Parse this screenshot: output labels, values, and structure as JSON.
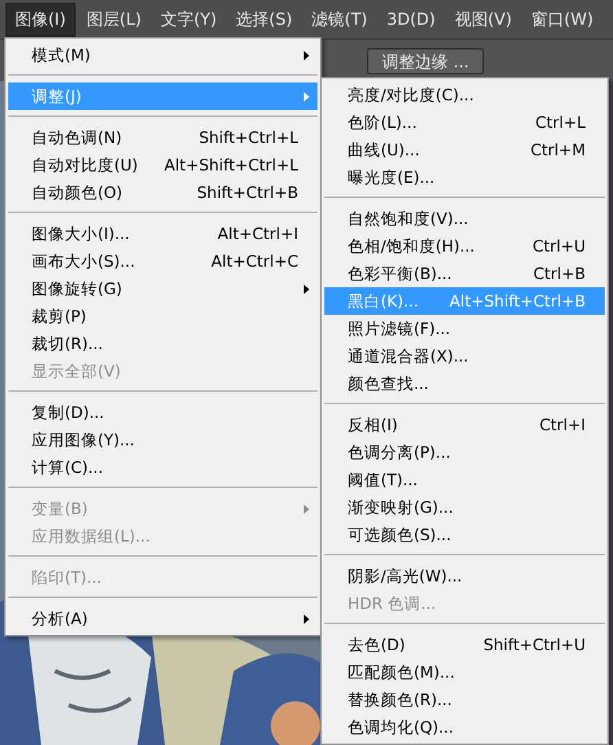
{
  "menu_bar": [
    {
      "label": "图像(I)",
      "selected": true
    },
    {
      "label": "图层(L)",
      "selected": false
    },
    {
      "label": "文字(Y)",
      "selected": false
    },
    {
      "label": "选择(S)",
      "selected": false
    },
    {
      "label": "滤镜(T)",
      "selected": false
    },
    {
      "label": "3D(D)",
      "selected": false
    },
    {
      "label": "视图(V)",
      "selected": false
    },
    {
      "label": "窗口(W)",
      "selected": false
    }
  ],
  "toolbar": {
    "button": "调整边缘 ..."
  },
  "image_menu": {
    "items": [
      {
        "kind": "item",
        "label": "模式(M)",
        "submenu": true,
        "disabled": false,
        "selected": false
      },
      {
        "kind": "separator"
      },
      {
        "kind": "item",
        "label": "调整(J)",
        "submenu": true,
        "disabled": false,
        "selected": true
      },
      {
        "kind": "separator"
      },
      {
        "kind": "item",
        "label": "自动色调(N)",
        "shortcut": "Shift+Ctrl+L",
        "disabled": false,
        "selected": false
      },
      {
        "kind": "item",
        "label": "自动对比度(U)",
        "shortcut": "Alt+Shift+Ctrl+L",
        "disabled": false,
        "selected": false
      },
      {
        "kind": "item",
        "label": "自动颜色(O)",
        "shortcut": "Shift+Ctrl+B",
        "disabled": false,
        "selected": false
      },
      {
        "kind": "separator"
      },
      {
        "kind": "item",
        "label": "图像大小(I)...",
        "shortcut": "Alt+Ctrl+I",
        "disabled": false,
        "selected": false
      },
      {
        "kind": "item",
        "label": "画布大小(S)...",
        "shortcut": "Alt+Ctrl+C",
        "disabled": false,
        "selected": false
      },
      {
        "kind": "item",
        "label": "图像旋转(G)",
        "submenu": true,
        "disabled": false,
        "selected": false
      },
      {
        "kind": "item",
        "label": "裁剪(P)",
        "disabled": false,
        "selected": false
      },
      {
        "kind": "item",
        "label": "裁切(R)...",
        "disabled": false,
        "selected": false
      },
      {
        "kind": "item",
        "label": "显示全部(V)",
        "disabled": true,
        "selected": false
      },
      {
        "kind": "separator"
      },
      {
        "kind": "item",
        "label": "复制(D)...",
        "disabled": false,
        "selected": false
      },
      {
        "kind": "item",
        "label": "应用图像(Y)...",
        "disabled": false,
        "selected": false
      },
      {
        "kind": "item",
        "label": "计算(C)...",
        "disabled": false,
        "selected": false
      },
      {
        "kind": "separator"
      },
      {
        "kind": "item",
        "label": "变量(B)",
        "submenu": true,
        "disabled": true,
        "selected": false
      },
      {
        "kind": "item",
        "label": "应用数据组(L)...",
        "disabled": true,
        "selected": false
      },
      {
        "kind": "separator"
      },
      {
        "kind": "item",
        "label": "陷印(T)...",
        "disabled": true,
        "selected": false
      },
      {
        "kind": "separator"
      },
      {
        "kind": "item",
        "label": "分析(A)",
        "submenu": true,
        "disabled": false,
        "selected": false
      }
    ]
  },
  "adjust_submenu": {
    "items": [
      {
        "kind": "item",
        "label": "亮度/对比度(C)...",
        "disabled": false,
        "selected": false
      },
      {
        "kind": "item",
        "label": "色阶(L)...",
        "shortcut": "Ctrl+L",
        "disabled": false,
        "selected": false
      },
      {
        "kind": "item",
        "label": "曲线(U)...",
        "shortcut": "Ctrl+M",
        "disabled": false,
        "selected": false
      },
      {
        "kind": "item",
        "label": "曝光度(E)...",
        "disabled": false,
        "selected": false
      },
      {
        "kind": "separator"
      },
      {
        "kind": "item",
        "label": "自然饱和度(V)...",
        "disabled": false,
        "selected": false
      },
      {
        "kind": "item",
        "label": "色相/饱和度(H)...",
        "shortcut": "Ctrl+U",
        "disabled": false,
        "selected": false
      },
      {
        "kind": "item",
        "label": "色彩平衡(B)...",
        "shortcut": "Ctrl+B",
        "disabled": false,
        "selected": false
      },
      {
        "kind": "item",
        "label": "黑白(K)...",
        "shortcut": "Alt+Shift+Ctrl+B",
        "disabled": false,
        "selected": true
      },
      {
        "kind": "item",
        "label": "照片滤镜(F)...",
        "disabled": false,
        "selected": false
      },
      {
        "kind": "item",
        "label": "通道混合器(X)...",
        "disabled": false,
        "selected": false
      },
      {
        "kind": "item",
        "label": "颜色查找...",
        "disabled": false,
        "selected": false
      },
      {
        "kind": "separator"
      },
      {
        "kind": "item",
        "label": "反相(I)",
        "shortcut": "Ctrl+I",
        "disabled": false,
        "selected": false
      },
      {
        "kind": "item",
        "label": "色调分离(P)...",
        "disabled": false,
        "selected": false
      },
      {
        "kind": "item",
        "label": "阈值(T)...",
        "disabled": false,
        "selected": false
      },
      {
        "kind": "item",
        "label": "渐变映射(G)...",
        "disabled": false,
        "selected": false
      },
      {
        "kind": "item",
        "label": "可选颜色(S)...",
        "disabled": false,
        "selected": false
      },
      {
        "kind": "separator"
      },
      {
        "kind": "item",
        "label": "阴影/高光(W)...",
        "disabled": false,
        "selected": false
      },
      {
        "kind": "item",
        "label": "HDR 色调...",
        "disabled": true,
        "selected": false
      },
      {
        "kind": "separator"
      },
      {
        "kind": "item",
        "label": "去色(D)",
        "shortcut": "Shift+Ctrl+U",
        "disabled": false,
        "selected": false
      },
      {
        "kind": "item",
        "label": "匹配颜色(M)...",
        "disabled": false,
        "selected": false
      },
      {
        "kind": "item",
        "label": "替换颜色(R)...",
        "disabled": false,
        "selected": false
      },
      {
        "kind": "item",
        "label": "色调均化(Q)...",
        "disabled": false,
        "selected": false
      }
    ]
  }
}
